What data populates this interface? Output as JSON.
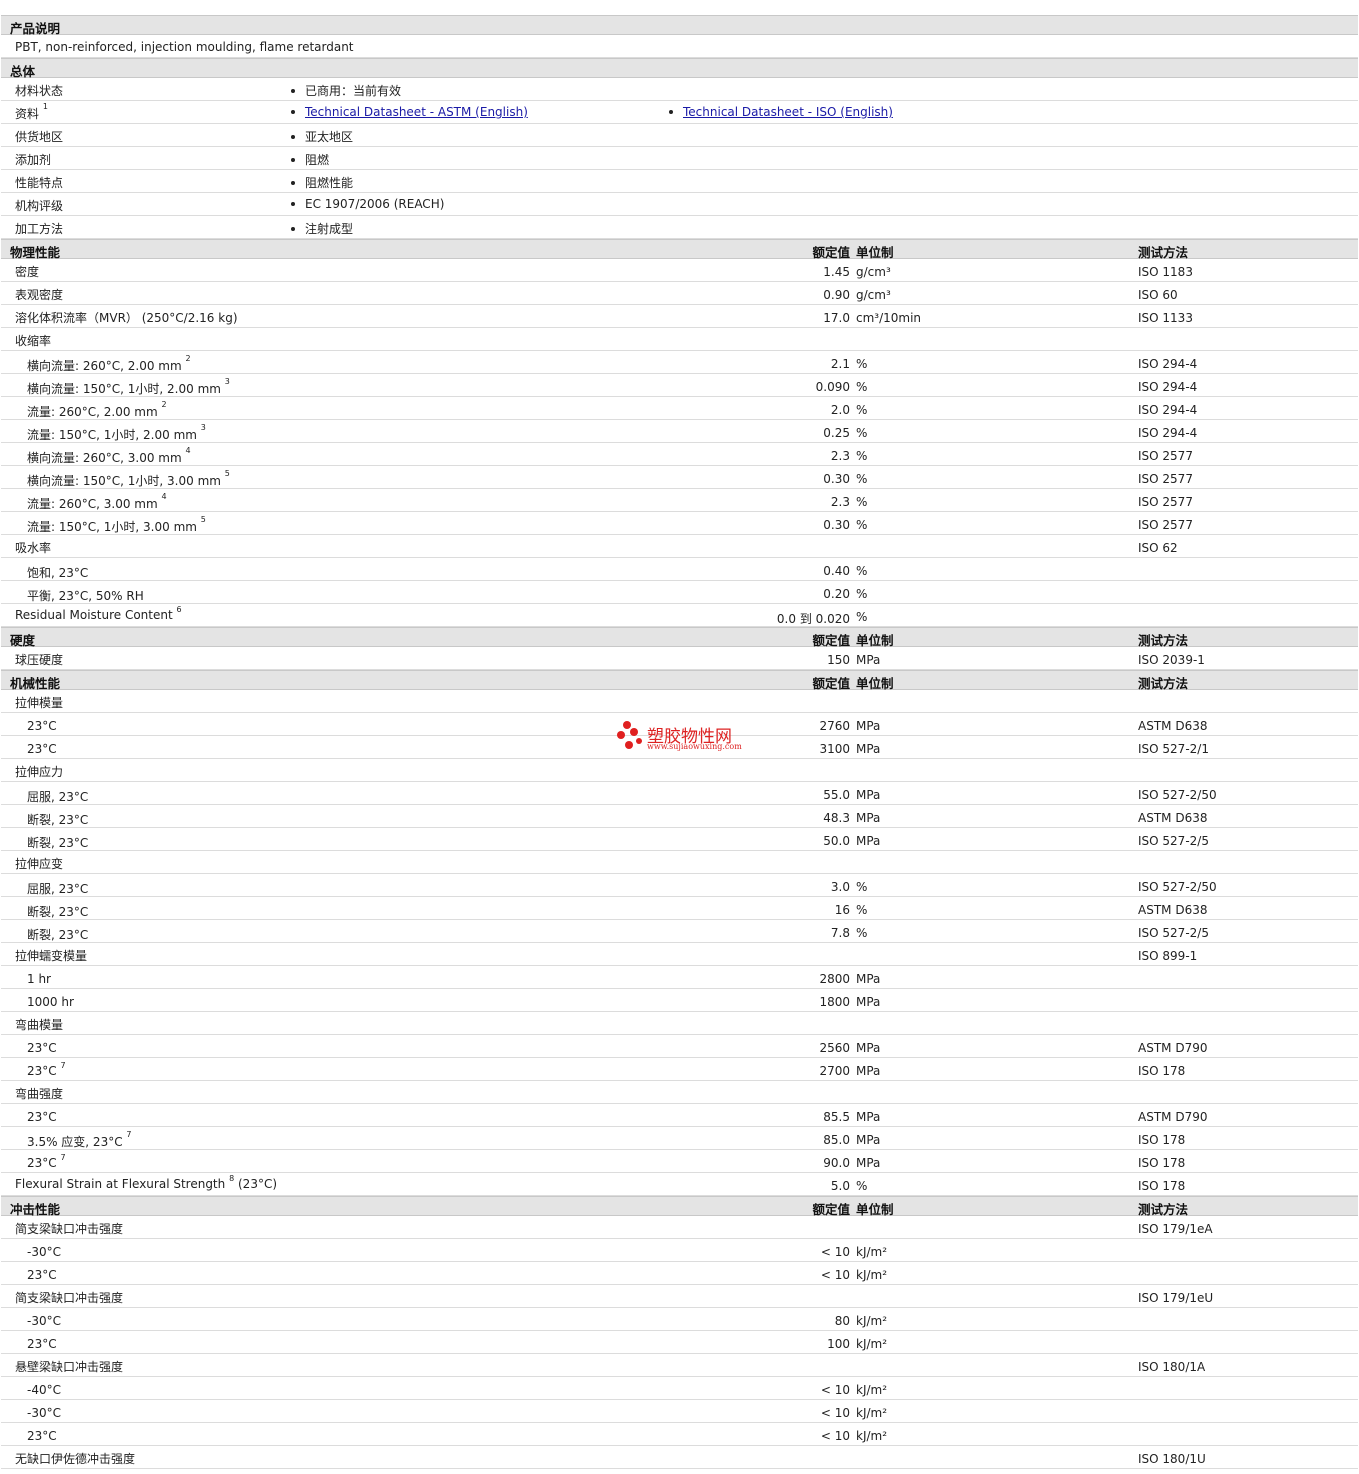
{
  "sections": {
    "product_desc": "产品说明",
    "general": "总体",
    "physical": "物理性能",
    "hardness": "硬度",
    "mechanical": "机械性能",
    "impact": "冲击性能"
  },
  "column_headers": {
    "value": "额定值",
    "unit": "单位制",
    "test": "测试方法"
  },
  "description": "PBT, non-reinforced, injection moulding, flame retardant",
  "general": [
    {
      "label": "材料状态",
      "items": [
        "已商用：当前有效"
      ]
    },
    {
      "label": "资料",
      "sup": "1",
      "links": [
        "Technical Datasheet - ASTM (English)",
        "Technical Datasheet - ISO (English)"
      ]
    },
    {
      "label": "供货地区",
      "items": [
        "亚太地区"
      ]
    },
    {
      "label": "添加剂",
      "items": [
        "阻燃"
      ]
    },
    {
      "label": "性能特点",
      "items": [
        "阻燃性能"
      ]
    },
    {
      "label": "机构评级",
      "items": [
        "EC 1907/2006 (REACH)"
      ]
    },
    {
      "label": "加工方法",
      "items": [
        "注射成型"
      ]
    }
  ],
  "physical_rows": [
    {
      "label": "密度",
      "value": "1.45",
      "unit": "g/cm³",
      "test": "ISO 1183"
    },
    {
      "label": "表观密度",
      "value": "0.90",
      "unit": "g/cm³",
      "test": "ISO 60"
    },
    {
      "label": "溶化体积流率（MVR） (250°C/2.16 kg)",
      "value": "17.0",
      "unit": "cm³/10min",
      "test": "ISO 1133"
    },
    {
      "label": "收缩率"
    },
    {
      "label": "横向流量: 260°C, 2.00 mm",
      "sup": "2",
      "value": "2.1",
      "unit": "%",
      "test": "ISO 294-4",
      "sub": true
    },
    {
      "label": "横向流量: 150°C, 1小时, 2.00 mm",
      "sup": "3",
      "value": "0.090",
      "unit": "%",
      "test": "ISO 294-4",
      "sub": true
    },
    {
      "label": "流量: 260°C, 2.00 mm",
      "sup": "2",
      "value": "2.0",
      "unit": "%",
      "test": "ISO 294-4",
      "sub": true
    },
    {
      "label": "流量: 150°C, 1小时, 2.00 mm",
      "sup": "3",
      "value": "0.25",
      "unit": "%",
      "test": "ISO 294-4",
      "sub": true
    },
    {
      "label": "横向流量: 260°C, 3.00 mm",
      "sup": "4",
      "value": "2.3",
      "unit": "%",
      "test": "ISO 2577",
      "sub": true
    },
    {
      "label": "横向流量: 150°C, 1小时, 3.00 mm",
      "sup": "5",
      "value": "0.30",
      "unit": "%",
      "test": "ISO 2577",
      "sub": true
    },
    {
      "label": "流量: 260°C, 3.00 mm",
      "sup": "4",
      "value": "2.3",
      "unit": "%",
      "test": "ISO 2577",
      "sub": true
    },
    {
      "label": "流量: 150°C, 1小时, 3.00 mm",
      "sup": "5",
      "value": "0.30",
      "unit": "%",
      "test": "ISO 2577",
      "sub": true
    },
    {
      "label": "吸水率",
      "test": "ISO 62"
    },
    {
      "label": "饱和, 23°C",
      "value": "0.40",
      "unit": "%",
      "sub": true
    },
    {
      "label": "平衡, 23°C, 50% RH",
      "value": "0.20",
      "unit": "%",
      "sub": true
    },
    {
      "label": "Residual Moisture Content",
      "sup": "6",
      "value": "0.0 到  0.020",
      "unit": "%"
    }
  ],
  "hardness_rows": [
    {
      "label": "球压硬度",
      "value": "150",
      "unit": "MPa",
      "test": "ISO 2039-1"
    }
  ],
  "mechanical_rows": [
    {
      "label": "拉伸模量"
    },
    {
      "label": "23°C",
      "value": "2760",
      "unit": "MPa",
      "test": "ASTM D638",
      "sub": true
    },
    {
      "label": "23°C",
      "value": "3100",
      "unit": "MPa",
      "test": "ISO 527-2/1",
      "sub": true
    },
    {
      "label": "拉伸应力"
    },
    {
      "label": "屈服, 23°C",
      "value": "55.0",
      "unit": "MPa",
      "test": "ISO 527-2/50",
      "sub": true
    },
    {
      "label": "断裂, 23°C",
      "value": "48.3",
      "unit": "MPa",
      "test": "ASTM D638",
      "sub": true
    },
    {
      "label": "断裂, 23°C",
      "value": "50.0",
      "unit": "MPa",
      "test": "ISO 527-2/5",
      "sub": true
    },
    {
      "label": "拉伸应变"
    },
    {
      "label": "屈服, 23°C",
      "value": "3.0",
      "unit": "%",
      "test": "ISO 527-2/50",
      "sub": true
    },
    {
      "label": "断裂, 23°C",
      "value": "16",
      "unit": "%",
      "test": "ASTM D638",
      "sub": true
    },
    {
      "label": "断裂, 23°C",
      "value": "7.8",
      "unit": "%",
      "test": "ISO 527-2/5",
      "sub": true
    },
    {
      "label": "拉伸蠕变模量",
      "test": "ISO 899-1"
    },
    {
      "label": "1 hr",
      "value": "2800",
      "unit": "MPa",
      "sub": true
    },
    {
      "label": "1000 hr",
      "value": "1800",
      "unit": "MPa",
      "sub": true
    },
    {
      "label": "弯曲模量"
    },
    {
      "label": "23°C",
      "value": "2560",
      "unit": "MPa",
      "test": "ASTM D790",
      "sub": true
    },
    {
      "label": "23°C",
      "sup": "7",
      "value": "2700",
      "unit": "MPa",
      "test": "ISO 178",
      "sub": true
    },
    {
      "label": "弯曲强度"
    },
    {
      "label": "23°C",
      "value": "85.5",
      "unit": "MPa",
      "test": "ASTM D790",
      "sub": true
    },
    {
      "label": "3.5% 应变, 23°C",
      "sup": "7",
      "value": "85.0",
      "unit": "MPa",
      "test": "ISO 178",
      "sub": true
    },
    {
      "label": "23°C",
      "sup": "7",
      "value": "90.0",
      "unit": "MPa",
      "test": "ISO 178",
      "sub": true
    },
    {
      "label": "Flexural Strain at Flexural Strength",
      "sup": "8",
      "label2": "(23°C)",
      "value": "5.0",
      "unit": "%",
      "test": "ISO 178"
    }
  ],
  "impact_rows": [
    {
      "label": "简支梁缺口冲击强度",
      "test": "ISO 179/1eA"
    },
    {
      "label": "-30°C",
      "value": "< 10",
      "unit": "kJ/m²",
      "sub": true
    },
    {
      "label": "23°C",
      "value": "< 10",
      "unit": "kJ/m²",
      "sub": true
    },
    {
      "label": "简支梁缺口冲击强度",
      "test": "ISO 179/1eU"
    },
    {
      "label": "-30°C",
      "value": "80",
      "unit": "kJ/m²",
      "sub": true
    },
    {
      "label": "23°C",
      "value": "100",
      "unit": "kJ/m²",
      "sub": true
    },
    {
      "label": "悬壁梁缺口冲击强度",
      "test": "ISO 180/1A"
    },
    {
      "label": "-40°C",
      "value": "< 10",
      "unit": "kJ/m²",
      "sub": true
    },
    {
      "label": "-30°C",
      "value": "< 10",
      "unit": "kJ/m²",
      "sub": true
    },
    {
      "label": "23°C",
      "value": "< 10",
      "unit": "kJ/m²",
      "sub": true
    },
    {
      "label": "无缺口伊佐德冲击强度",
      "test": "ISO 180/1U"
    }
  ],
  "watermark": {
    "name": "塑胶物性网",
    "url": "www.sujiaowuxing.com"
  }
}
